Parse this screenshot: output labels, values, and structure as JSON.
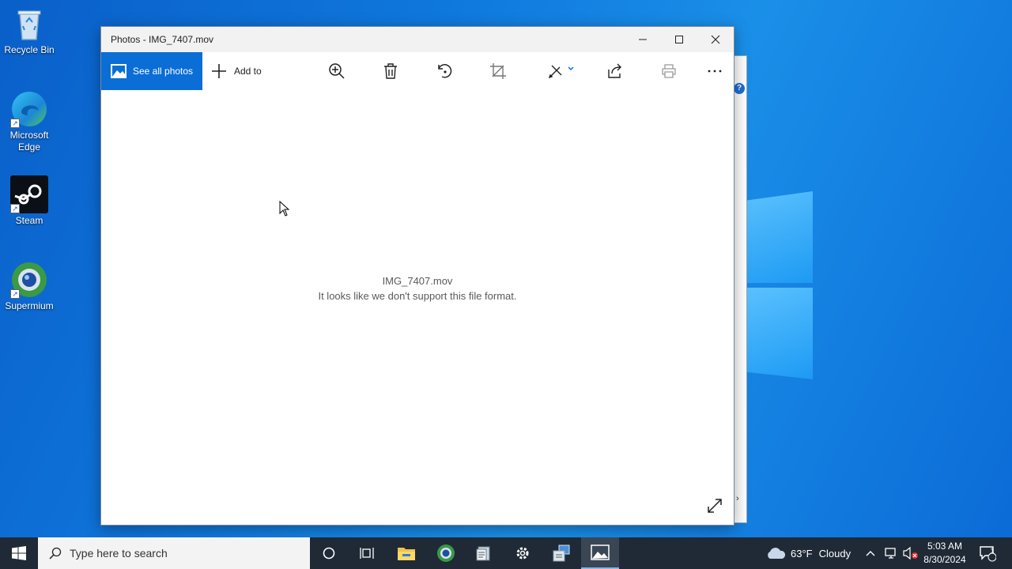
{
  "desktop": {
    "icons": [
      {
        "label": "Recycle Bin",
        "icon": "recycle-bin-icon"
      },
      {
        "label": "Microsoft Edge",
        "icon": "edge-icon"
      },
      {
        "label": "Steam",
        "icon": "steam-icon"
      },
      {
        "label": "Supermium",
        "icon": "supermium-icon"
      }
    ]
  },
  "window": {
    "title": "Photos - IMG_7407.mov",
    "controls": [
      "minimize-icon",
      "maximize-icon",
      "close-icon"
    ]
  },
  "toolbar": {
    "see_all_label": "See all photos",
    "add_to_label": "Add to",
    "tools": [
      "zoom-icon",
      "delete-icon",
      "rotate-icon",
      "crop-icon",
      "edit-icon",
      "share-icon",
      "print-icon",
      "more-icon"
    ]
  },
  "content": {
    "filename": "IMG_7407.mov",
    "error": "It looks like we don't support this file format."
  },
  "taskbar": {
    "search_placeholder": "Type here to search",
    "weather_temp": "63°F",
    "weather_desc": "Cloudy",
    "time": "5:03 AM",
    "date": "8/30/2024",
    "notification_count": "1"
  },
  "colors": {
    "accent": "#0a6ed6",
    "taskbar": "#1f2a36",
    "titlebar": "#f2f2f2"
  }
}
